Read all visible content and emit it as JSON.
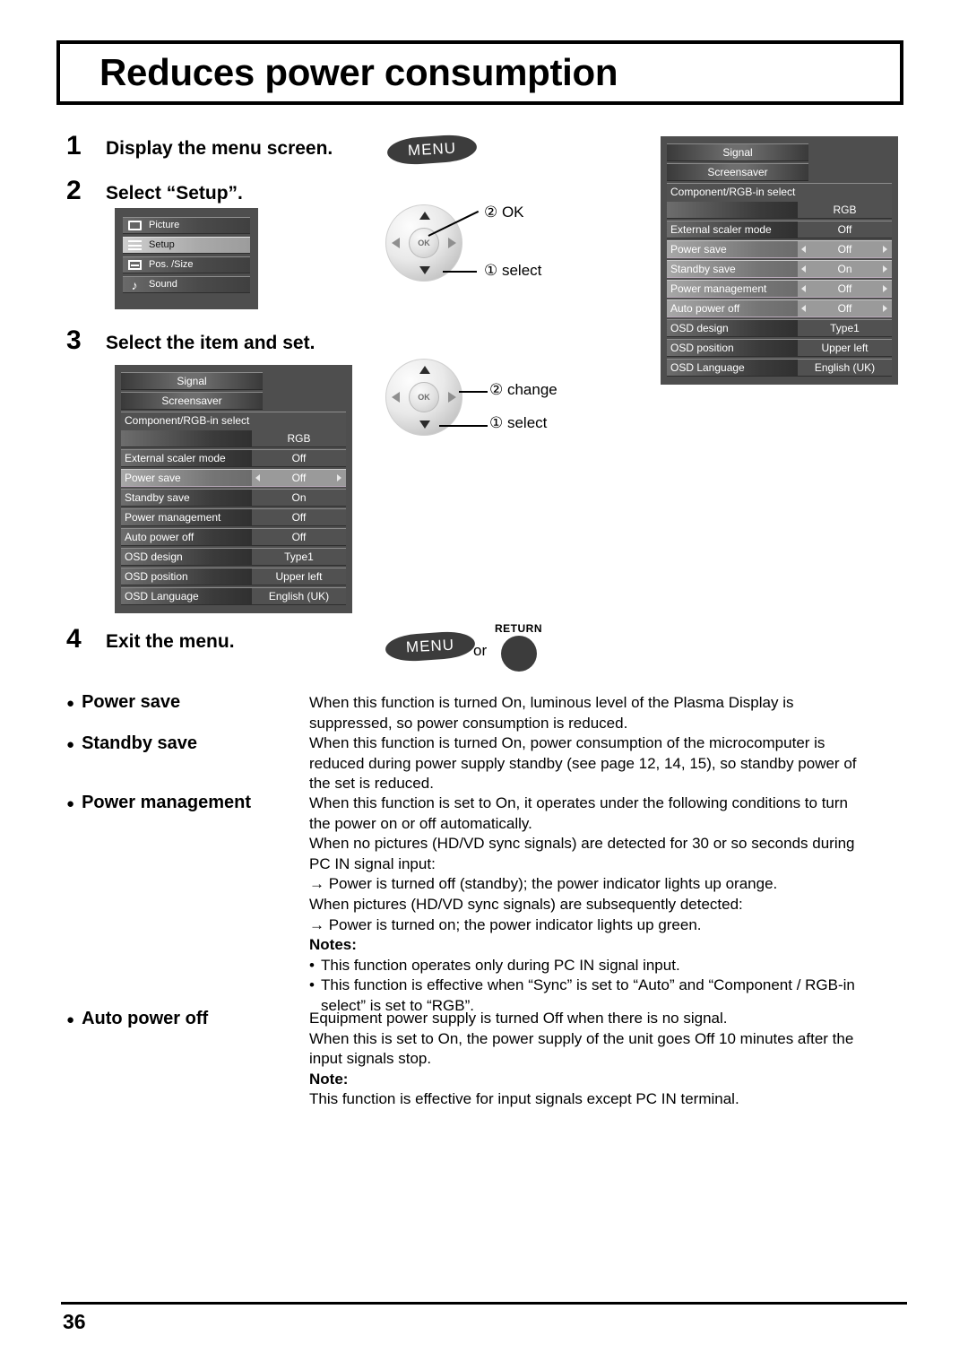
{
  "header": {
    "title": "Reduces power consumption"
  },
  "steps": [
    {
      "num": "1",
      "text": "Display the menu screen."
    },
    {
      "num": "2",
      "text": "Select “Setup”."
    },
    {
      "num": "3",
      "text": "Select the item and set."
    },
    {
      "num": "4",
      "text": "Exit the menu."
    }
  ],
  "remote": {
    "menu_label": "MENU",
    "ok_label": "OK",
    "return_label": "RETURN",
    "or_label": "or",
    "callouts": {
      "ok": "② OK",
      "select1": "① select",
      "change": "② change",
      "select2": "① select"
    }
  },
  "main_menu": {
    "items": [
      {
        "label": "Picture",
        "icon": "picture-icon",
        "selected": false
      },
      {
        "label": "Setup",
        "icon": "setup-icon",
        "selected": true
      },
      {
        "label": "Pos. /Size",
        "icon": "position-icon",
        "selected": false
      },
      {
        "label": "Sound",
        "icon": "sound-icon",
        "selected": false
      }
    ]
  },
  "setup_menu_left": {
    "headers": [
      "Signal",
      "Screensaver"
    ],
    "rows": [
      {
        "label": "Component/RGB-in select",
        "value": "RGB",
        "twoline": true,
        "selected": false,
        "arrows": false
      },
      {
        "label": "External scaler mode",
        "value": "Off",
        "twoline": false,
        "selected": false,
        "arrows": false
      },
      {
        "label": "Power save",
        "value": "Off",
        "twoline": false,
        "selected": true,
        "arrows": true
      },
      {
        "label": "Standby save",
        "value": "On",
        "twoline": false,
        "selected": false,
        "arrows": false
      },
      {
        "label": "Power management",
        "value": "Off",
        "twoline": false,
        "selected": false,
        "arrows": false
      },
      {
        "label": "Auto power off",
        "value": "Off",
        "twoline": false,
        "selected": false,
        "arrows": false
      },
      {
        "label": "OSD design",
        "value": "Type1",
        "twoline": false,
        "selected": false,
        "arrows": false
      },
      {
        "label": "OSD position",
        "value": "Upper left",
        "twoline": false,
        "selected": false,
        "arrows": false
      },
      {
        "label": "OSD Language",
        "value": "English (UK)",
        "twoline": false,
        "selected": false,
        "arrows": false
      }
    ]
  },
  "setup_menu_right": {
    "headers": [
      "Signal",
      "Screensaver"
    ],
    "rows": [
      {
        "label": "Component/RGB-in select",
        "value": "RGB",
        "twoline": true,
        "selected": false,
        "arrows": false
      },
      {
        "label": "External scaler mode",
        "value": "Off",
        "twoline": false,
        "selected": false,
        "arrows": false
      },
      {
        "label": "Power save",
        "value": "Off",
        "twoline": false,
        "selected": true,
        "arrows": true
      },
      {
        "label": "Standby save",
        "value": "On",
        "twoline": false,
        "selected": true,
        "arrows": true
      },
      {
        "label": "Power management",
        "value": "Off",
        "twoline": false,
        "selected": true,
        "arrows": true
      },
      {
        "label": "Auto power off",
        "value": "Off",
        "twoline": false,
        "selected": true,
        "arrows": true
      },
      {
        "label": "OSD design",
        "value": "Type1",
        "twoline": false,
        "selected": false,
        "arrows": false
      },
      {
        "label": "OSD position",
        "value": "Upper left",
        "twoline": false,
        "selected": false,
        "arrows": false
      },
      {
        "label": "OSD Language",
        "value": "English (UK)",
        "twoline": false,
        "selected": false,
        "arrows": false
      }
    ]
  },
  "descriptions": {
    "power_save": {
      "term": "Power save",
      "lines": [
        "When this function is turned On, luminous level of the Plasma Display is",
        "suppressed, so power consumption is reduced."
      ]
    },
    "standby_save": {
      "term": "Standby save",
      "lines": [
        "When this function is turned On, power consumption of the microcomputer is",
        "reduced during power supply standby (see page 12, 14, 15), so standby power of",
        "the set is reduced."
      ]
    },
    "power_management": {
      "term": "Power management",
      "lines": [
        "When this function is set to On, it operates under the following conditions to turn",
        "the power on or off automatically.",
        "When no pictures (HD/VD sync signals) are detected for 30 or so seconds during",
        "PC IN signal input:",
        "→ Power is turned off (standby); the power indicator lights up orange.",
        "When pictures (HD/VD sync signals) are subsequently detected:",
        "→ Power is turned on; the power indicator lights up green."
      ],
      "notes_heading": "Notes:",
      "notes": [
        "This function operates only during PC IN signal input.",
        "This function is effective when “Sync” is set to “Auto” and “Component / RGB-in"
      ],
      "notes_cont": "select” is set to “RGB”."
    },
    "auto_power_off": {
      "term": "Auto power off",
      "lines": [
        "Equipment power supply is turned Off when there is no signal.",
        "When this is set to On, the power supply of the unit goes Off 10 minutes after the",
        "input signals stop."
      ],
      "note_heading": "Note:",
      "note": "This function is effective for input signals except PC IN terminal."
    }
  },
  "footer": {
    "page_number": "36"
  }
}
